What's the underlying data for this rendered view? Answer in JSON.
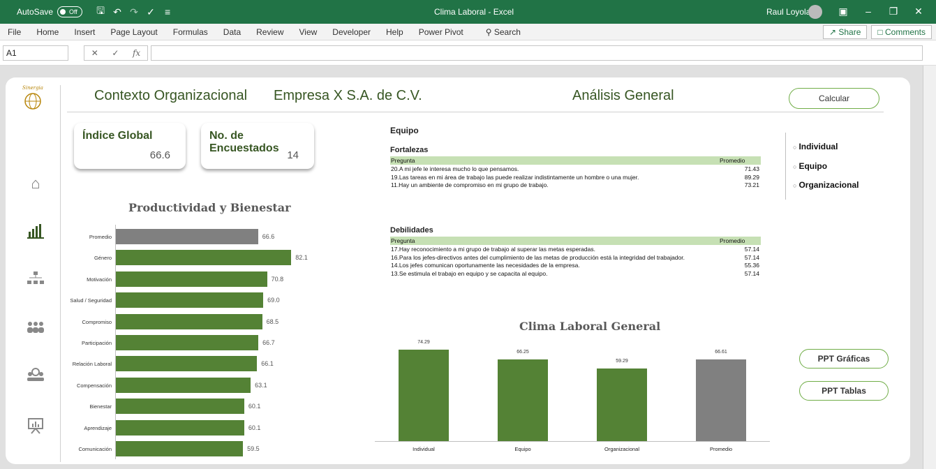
{
  "titlebar": {
    "autosave_label": "AutoSave",
    "autosave_state": "Off",
    "title": "Clima Laboral - Excel",
    "user": "Raul Loyola"
  },
  "menu": [
    "File",
    "Home",
    "Insert",
    "Page Layout",
    "Formulas",
    "Data",
    "Review",
    "View",
    "Developer",
    "Help",
    "Power Pivot"
  ],
  "search_label": "Search",
  "share_label": "Share",
  "comments_label": "Comments",
  "formula": {
    "namebox": "A1",
    "fx": "fx",
    "value": ""
  },
  "dashboard": {
    "logo_text": "Sinergia",
    "title_context": "Contexto Organizacional",
    "title_company": "Empresa X S.A. de C.V.",
    "title_analysis": "Análisis General",
    "calc_button": "Calcular",
    "kpi_global_label": "Índice Global",
    "kpi_global_value": "66.6",
    "kpi_count_label": "No. de Encuestados",
    "kpi_count_value": "14",
    "section_title": "Equipo",
    "strengths_title": "Fortalezas",
    "weaknesses_title": "Debilidades",
    "col_question": "Pregunta",
    "col_average": "Promedio",
    "strengths": [
      {
        "q": "20.A mi jefe le interesa mucho lo que pensamos.",
        "v": "71.43"
      },
      {
        "q": "19.Las tareas en mi área de trabajo las puede realizar indistintamente un hombre o una mujer.",
        "v": "89.29"
      },
      {
        "q": "11.Hay un ambiente de compromiso en mi grupo de trabajo.",
        "v": "73.21"
      }
    ],
    "weaknesses": [
      {
        "q": "17.Hay reconocimiento a mi grupo de trabajo al superar las metas esperadas.",
        "v": "57.14"
      },
      {
        "q": "16.Para los jefes-directivos antes del cumplimiento de las metas de producción está la integridad del trabajador.",
        "v": "57.14"
      },
      {
        "q": "14.Los jefes comunican oportunamente las necesidades de la empresa.",
        "v": "55.36"
      },
      {
        "q": "13.Se estimula el trabajo en equipo y se capacita al equipo.",
        "v": "57.14"
      }
    ],
    "radios": [
      "Individual",
      "Equipo",
      "Organizacional"
    ],
    "ppt_graphs": "PPT Gráficas",
    "ppt_tables": "PPT Tablas"
  },
  "colors": {
    "green": "#548235",
    "gray": "#808080",
    "excel_green": "#217346",
    "header_green": "#c6e0b4"
  },
  "chart_data": [
    {
      "type": "bar",
      "orientation": "horizontal",
      "title": "Productividad y Bienestar",
      "categories": [
        "Promedio",
        "Género",
        "Motivación",
        "Salud / Seguridad",
        "Compromiso",
        "Participación",
        "Relación Laboral",
        "Compensación",
        "Bienestar",
        "Aprendizaje",
        "Comunicación"
      ],
      "values": [
        66.6,
        82.1,
        70.8,
        69.0,
        68.5,
        66.7,
        66.1,
        63.1,
        60.1,
        60.1,
        59.5
      ],
      "labels": [
        "66.6",
        "82.1",
        "70.8",
        "69.0",
        "68.5",
        "66.7",
        "66.1",
        "63.1",
        "60.1",
        "60.1",
        "59.5"
      ],
      "highlight": "Promedio"
    },
    {
      "type": "bar",
      "title": "Clima Laboral General",
      "categories": [
        "Individual",
        "Equipo",
        "Organizacional",
        "Promedio"
      ],
      "values": [
        74.29,
        66.25,
        59.29,
        66.61
      ],
      "labels": [
        "74.29",
        "66.25",
        "59.29",
        "66.61"
      ],
      "highlight": "Promedio"
    }
  ]
}
